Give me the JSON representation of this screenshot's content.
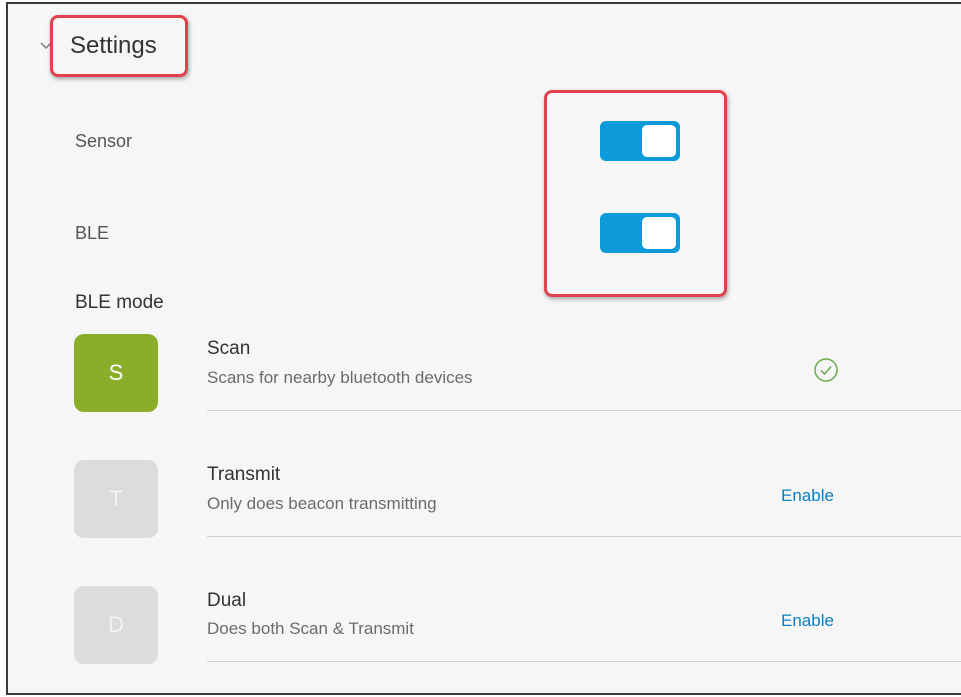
{
  "section": {
    "title": "Settings"
  },
  "settings": {
    "sensor": {
      "label": "Sensor",
      "enabled": true
    },
    "ble": {
      "label": "BLE",
      "enabled": true
    }
  },
  "ble_mode": {
    "heading": "BLE mode",
    "modes": [
      {
        "letter": "S",
        "name": "Scan",
        "description": "Scans for nearby bluetooth devices",
        "active": true,
        "status_icon": "check-circle-icon"
      },
      {
        "letter": "T",
        "name": "Transmit",
        "description": "Only does beacon transmitting",
        "active": false,
        "action_label": "Enable"
      },
      {
        "letter": "D",
        "name": "Dual",
        "description": "Does both Scan & Transmit",
        "active": false,
        "action_label": "Enable"
      }
    ]
  },
  "colors": {
    "toggle_on": "#0d9ad9",
    "active_tile": "#8aad2a",
    "inactive_tile": "#dcdcdc",
    "link": "#0a7fc2",
    "highlight": "#e0414b",
    "check": "#6aa84f"
  }
}
